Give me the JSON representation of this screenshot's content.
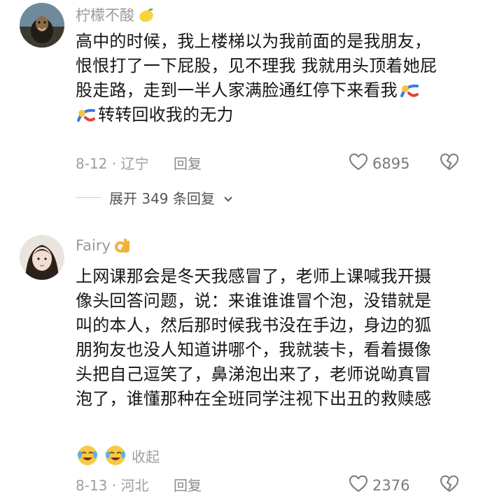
{
  "comments": [
    {
      "username": "柠檬不酸",
      "username_emoji": "lemon-icon",
      "lines": [
        "高中的时候，我上楼梯以为我前面的是我朋友，",
        "恨恨打了一下屁股，见不理我 我就用头顶着她屁",
        "股走路，走到一半人家满脸通红停下来看我",
        "转转回收我的无力"
      ],
      "date_location": "8-12 · 辽宁",
      "reply_label": "回复",
      "likes": "6895",
      "expand_label": "展开 349 条回复"
    },
    {
      "username": "Fairy",
      "username_emoji": "ok-hand-icon",
      "lines": [
        "上网课那会是冬天我感冒了，老师上课喊我开摄",
        "像头回答问题，说：来谁谁谁冒个泡，没错就是",
        "叫的本人，然后那时候我书没在手边，身边的狐",
        "朋狗友也没人知道讲哪个，我就装卡，看着摄像",
        "头把自己逗笑了，鼻涕泡出来了，老师说呦真冒",
        "泡了，谁懂那种在全班同学注视下出丑的救赎感"
      ],
      "collapse_label": "收起",
      "date_location": "8-13 · 河北",
      "reply_label": "回复",
      "likes": "2376"
    }
  ],
  "colors": {
    "username": "#9a9a9a",
    "body_text": "#161616",
    "meta": "#9e9e9e",
    "background": "#ffffff"
  }
}
